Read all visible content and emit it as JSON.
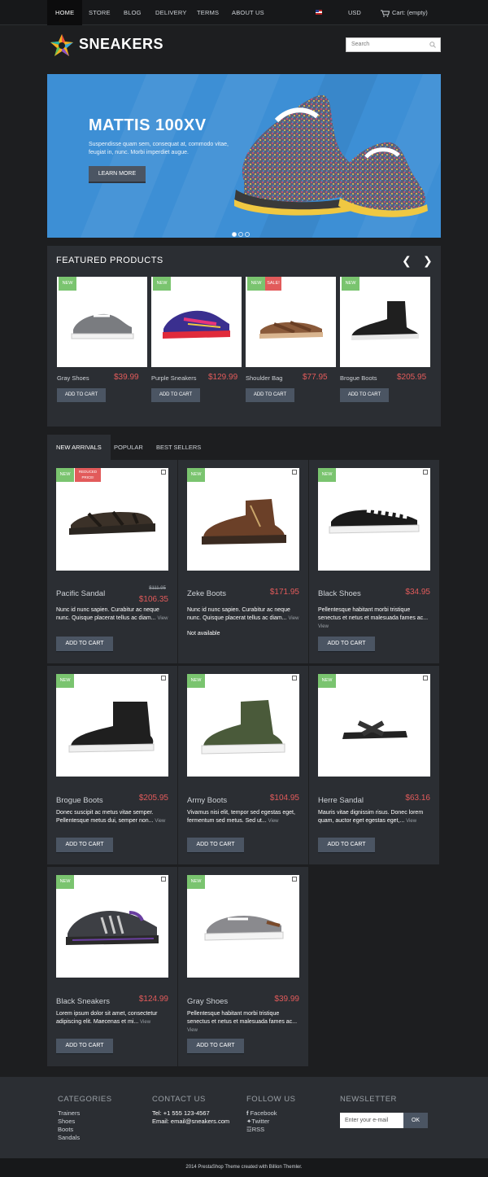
{
  "topnav": {
    "items": [
      "HOME",
      "STORE",
      "BLOG",
      "DELIVERY",
      "TERMS",
      "ABOUT US"
    ],
    "currency": "USD",
    "cart": "Cart: (empty)"
  },
  "header": {
    "brand": "SNEAKERS",
    "search_placeholder": "Search"
  },
  "hero": {
    "title": "MATTIS 100XV",
    "text": "Suspendisse quam sem, consequat at, commodo vitae, feugiat in, nunc. Morbi imperdiet augue.",
    "button": "LEARN MORE",
    "slides": 3,
    "active_slide": 1
  },
  "featured": {
    "title": "FEATURED PRODUCTS",
    "products": [
      {
        "name": "Gray Shoes",
        "price": "$39.99",
        "badges": [
          "NEW"
        ]
      },
      {
        "name": "Purple Sneakers",
        "price": "$129.99",
        "badges": [
          "NEW"
        ]
      },
      {
        "name": "Shoulder Bag",
        "price": "$77.95",
        "badges": [
          "NEW",
          "SALE!"
        ]
      },
      {
        "name": "Brogue Boots",
        "price": "$205.95",
        "badges": [
          "NEW"
        ]
      }
    ],
    "button": "ADD TO CART"
  },
  "tabs": [
    "NEW ARRIVALS",
    "POPULAR",
    "BEST SELLERS"
  ],
  "products": [
    {
      "name": "Pacific Sandal",
      "old_price": "$111.95",
      "price": "$106.35",
      "badge2": "REDUCED PRICE!",
      "desc": "Nunc id nunc sapien. Curabitur ac neque nunc. Quisque placerat tellus ac diam...",
      "view": "View"
    },
    {
      "name": "Zeke Boots",
      "price": "$171.95",
      "desc": "Nunc id nunc sapien. Curabitur ac neque nunc. Quisque placerat tellus ac diam...",
      "view": "View",
      "availability": "Not available"
    },
    {
      "name": "Black Shoes",
      "price": "$34.95",
      "desc": "Pellentesque habitant morbi tristique senectus et netus et malesuada fames ac...",
      "view": "View"
    },
    {
      "name": "Brogue Boots",
      "price": "$205.95",
      "desc": "Donec suscipit ac metus vitae semper. Pellentesque metus dui, semper non...",
      "view": "View"
    },
    {
      "name": "Army Boots",
      "price": "$104.95",
      "desc": "Vivamus nisi elit, tempor sed egestas eget, fermentum sed metus. Sed ut...",
      "view": "View"
    },
    {
      "name": "Herre Sandal",
      "price": "$63.16",
      "desc": "Mauris vitae dignissim risus. Donec lorem quam, auctor eget egestas eget,...",
      "view": "View"
    },
    {
      "name": "Black Sneakers",
      "price": "$124.99",
      "desc": "Lorem ipsum dolor sit amet, consectetur adipiscing elit. Maecenas et mi...",
      "view": "View"
    },
    {
      "name": "Gray Shoes",
      "price": "$39.99",
      "desc": "Pellentesque habitant morbi tristique senectus et netus et malesuada fames ac...",
      "view": "View"
    }
  ],
  "badge_new": "NEW",
  "add_to_cart": "ADD TO CART",
  "footer": {
    "categories_title": "CATEGORIES",
    "categories": [
      "Trainers",
      "Shoes",
      "Boots",
      "Sandals"
    ],
    "contact_title": "CONTACT US",
    "tel": "Tel: +1 555 123-4567",
    "email": "Email: email@sneakers.com",
    "follow_title": "FOLLOW US",
    "follow": [
      "Facebook",
      "Twitter",
      "RSS"
    ],
    "newsletter_title": "NEWSLETTER",
    "newsletter_placeholder": "Enter your e-mail",
    "newsletter_button": "OK",
    "copyright": "2014 PrestaShop Theme created with Billion Themler."
  },
  "colors": {
    "accent_price": "#e25b5b",
    "badge_new": "#7ac46f",
    "hero_bg": "#3d8fd5",
    "panel": "#2b2e33"
  }
}
